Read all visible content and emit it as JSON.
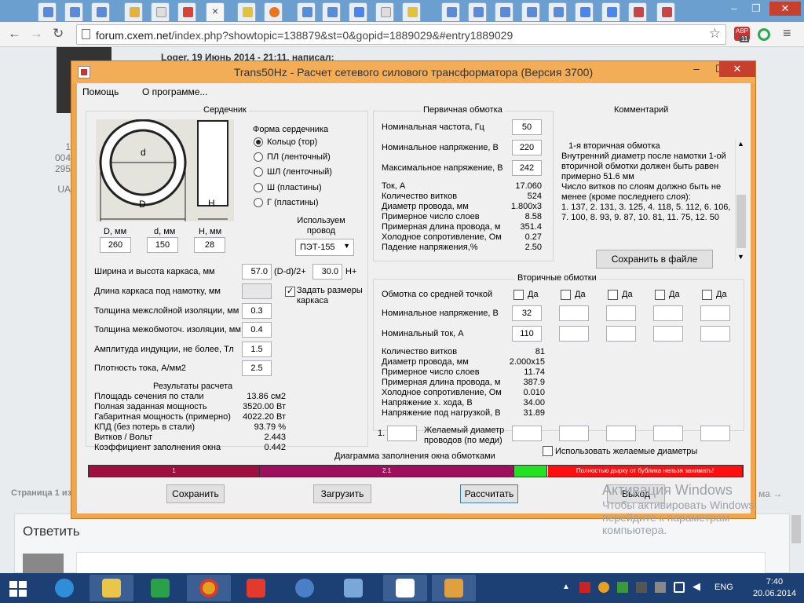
{
  "browser": {
    "url_host": "forum.cxem.net",
    "url_path": "/index.php?showtopic=138879&st=0&gopid=1889029&#entry1889029",
    "ext_badge": "11"
  },
  "page": {
    "posted_by": "Loger, 19 Июнь 2014 - 21:11, написал:",
    "left_info": [
      "1 004",
      "295",
      "UA"
    ],
    "pager": "Страница 1 из",
    "reply_heading": "Ответить",
    "next_link": "ма →"
  },
  "app": {
    "title": "Trans50Hz - Расчет сетевого силового трансформатора (Версия 3700)",
    "menu": [
      "Помощь",
      "О программе..."
    ],
    "core": {
      "group_title": "Сердечник",
      "shape_title": "Форма сердечника",
      "shapes": [
        "Кольцо  (тор)",
        "ПЛ  (ленточный)",
        "ШЛ  (ленточный)",
        "Ш  (пластины)",
        "Г (пластины)"
      ],
      "selected_shape": 0,
      "img_d": "d",
      "img_D": "D",
      "img_H": "H",
      "dim_labels": [
        "D, мм",
        "d, мм",
        "H, мм"
      ],
      "dim_values": [
        "260",
        "150",
        "28"
      ],
      "wire_label": "Используем провод",
      "wire_value": "ПЭТ-155",
      "frame_label": "Ширина и высота каркаса, мм",
      "frame_w": "57.0",
      "frame_w_note": "(D-d)/2+",
      "frame_h": "30.0",
      "frame_h_note": "H+",
      "length_label": "Длина каркаса под намотку, мм",
      "set_frame_label": "Задать размеры каркаса",
      "set_frame_checked": true,
      "interlayer_label": "Толщина межслойной изоляции, мм",
      "interlayer_value": "0.3",
      "interwinding_label": "Толщина межобмоточ. изоляции, мм",
      "interwinding_value": "0.4",
      "induction_label": "Амплитуда индукции, не более, Тл",
      "induction_value": "1.5",
      "current_density_label": "Плотность тока, А/мм2",
      "current_density_value": "2.5",
      "results_title": "Результаты расчета",
      "results": [
        {
          "label": "Площадь сечения по стали",
          "value": "13.86 см2"
        },
        {
          "label": "Полная заданная мощность",
          "value": "3520.00 Вт"
        },
        {
          "label": "Габаритная мощность (примерно)",
          "value": "4022.20 Вт"
        },
        {
          "label": "КПД (без потерь в стали)",
          "value": "93.79 %"
        },
        {
          "label": "Витков / Вольт",
          "value": "2.443"
        },
        {
          "label": "Коэффициент заполнения окна",
          "value": "0.442"
        }
      ]
    },
    "primary": {
      "group_title": "Первичная обмотка",
      "freq_label": "Номинальная частота, Гц",
      "freq_value": "50",
      "voltage_label": "Номинальное напряжение, В",
      "voltage_value": "220",
      "max_voltage_label": "Максимальное напряжение, В",
      "max_voltage_value": "242",
      "results": [
        {
          "label": "Ток, А",
          "value": "17.060"
        },
        {
          "label": "Количество витков",
          "value": "524"
        },
        {
          "label": "Диаметр провода, мм",
          "value": "1.800x3"
        },
        {
          "label": "Примерное число слоев",
          "value": "8.58"
        },
        {
          "label": "Примерная длина провода, м",
          "value": "351.4"
        },
        {
          "label": "Холодное сопротивление, Ом",
          "value": "0.27"
        },
        {
          "label": "Падение напряжения,%",
          "value": "2.50"
        }
      ]
    },
    "comment": {
      "title": "Комментарий",
      "text": "   1-я вторичная обмотка\nВнутренний диаметр после намотки 1-ой вторичной обмотки должен быть равен примерно 51.6 мм\nЧисло витков по слоям должно быть не менее (кроме последнего слоя):\n1. 137, 2. 131, 3. 125, 4. 118, 5. 112, 6. 106, 7. 100, 8. 93, 9. 87, 10. 81, 11. 75, 12. 50",
      "save_button": "Сохранить в файле"
    },
    "secondary": {
      "group_title": "Вторичные обмотки",
      "center_tap_label": "Обмотка со средней точкой",
      "yes_label": "Да",
      "voltage_label": "Номинальное напряжение, В",
      "current_label": "Номинальный ток, А",
      "voltages": [
        "32",
        "",
        "",
        "",
        ""
      ],
      "currents": [
        "110",
        "",
        "",
        "",
        ""
      ],
      "results": [
        {
          "label": "Количество витков",
          "value": "81"
        },
        {
          "label": "Диаметр провода, мм",
          "value": "2.000x15"
        },
        {
          "label": "Примерное число слоев",
          "value": "11.74"
        },
        {
          "label": "Примерная длина провода, м",
          "value": "387.9"
        },
        {
          "label": "Холодное сопротивление, Ом",
          "value": "0.010"
        },
        {
          "label": "Напряжение х. хода, В",
          "value": "34.00"
        },
        {
          "label": "Напряжение под нагрузкой, В",
          "value": "31.89"
        }
      ],
      "desired_prefix": "1.",
      "desired_label": "Желаемый диаметр проводов  (по меди)",
      "use_desired_label": "Использовать желаемые диаметры"
    },
    "diagram": {
      "title": "Диаграмма заполнения окна обмотками",
      "segments": [
        {
          "label": "1",
          "fraction": 0.262,
          "color": "#9e0f40"
        },
        {
          "label": "2.1",
          "fraction": 0.389,
          "color": "#9e0f5e"
        },
        {
          "label": "",
          "fraction": 0.051,
          "color": "#22e122"
        },
        {
          "label": "Полностью дырку от бублика нельзя занимать!",
          "fraction": 0.298,
          "color": "#ff1010"
        }
      ]
    },
    "buttons": {
      "save": "Сохранить",
      "load": "Загрузить",
      "calc": "Рассчитать",
      "exit": "Выход"
    }
  },
  "watermark": {
    "line1": "Активация Windows",
    "line2": "Чтобы активировать Windows,",
    "line3": "перейдите к параметрам",
    "line4": "компьютера."
  },
  "taskbar": {
    "lang": "ENG",
    "time": "7:40",
    "date": "20.06.2014"
  }
}
